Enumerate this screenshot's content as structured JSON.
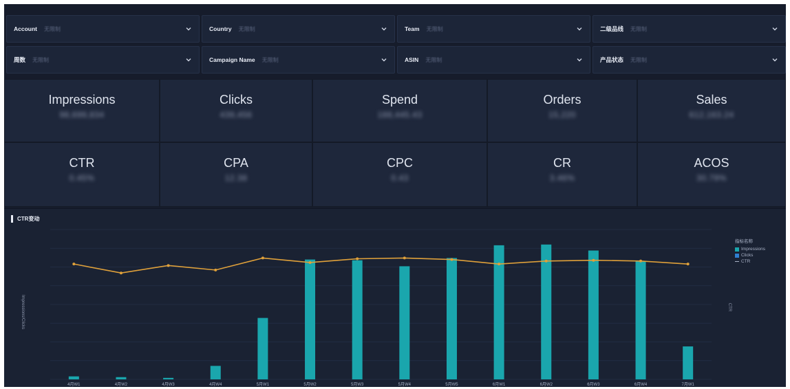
{
  "filters": [
    {
      "label": "Account",
      "value": "无限制"
    },
    {
      "label": "Country",
      "value": "无限制"
    },
    {
      "label": "Team",
      "value": "无限制"
    },
    {
      "label": "二级品线",
      "value": "无限制"
    },
    {
      "label": "周数",
      "value": "无限制"
    },
    {
      "label": "Campaign Name",
      "value": "无限制"
    },
    {
      "label": "ASIN",
      "value": "无限制"
    },
    {
      "label": "产品状态",
      "value": "无限制"
    }
  ],
  "kpis": [
    {
      "title": "Impressions",
      "value": "98,699,834"
    },
    {
      "title": "Clicks",
      "value": "439,456"
    },
    {
      "title": "Spend",
      "value": "188,445.43"
    },
    {
      "title": "Orders",
      "value": "15,220"
    },
    {
      "title": "Sales",
      "value": "612,163.24"
    },
    {
      "title": "CTR",
      "value": "0.45%"
    },
    {
      "title": "CPA",
      "value": "12.38"
    },
    {
      "title": "CPC",
      "value": "0.43"
    },
    {
      "title": "CR",
      "value": "3.46%"
    },
    {
      "title": "ACOS",
      "value": "30.79%"
    }
  ],
  "chart": {
    "title": "CTR变动",
    "left_axis_label": "Impressions/Clicks",
    "right_axis_label": "CTR",
    "legend_title": "指标名称",
    "legend_items": [
      "Impressions",
      "Clicks",
      "CTR"
    ],
    "colors": {
      "impressions": "#1aa6ad",
      "clicks": "#2f7fd1",
      "ctr": "#e0a13a"
    }
  },
  "chart_data": {
    "type": "bar",
    "categories": [
      "4月W1",
      "4月W2",
      "4月W3",
      "4月W4",
      "5月W1",
      "5月W2",
      "5月W3",
      "5月W4",
      "5月W5",
      "6月W1",
      "6月W2",
      "6月W3",
      "6月W4",
      "7月W1"
    ],
    "series": [
      {
        "name": "Impressions",
        "type": "bar",
        "axis": "left",
        "values": [
          2,
          1.5,
          1,
          9,
          41,
          80,
          79.5,
          75.5,
          81,
          89.5,
          90,
          86,
          79,
          22
        ]
      },
      {
        "name": "Clicks",
        "type": "bar",
        "axis": "left",
        "values": [
          0,
          0,
          0,
          0,
          0,
          0,
          0,
          0,
          0,
          0,
          0,
          0,
          0,
          0
        ]
      },
      {
        "name": "CTR",
        "type": "line",
        "axis": "right",
        "values": [
          77,
          71,
          76,
          73,
          81,
          78,
          80.5,
          81,
          80,
          77,
          79,
          79.5,
          79,
          77
        ]
      }
    ],
    "ylim": [
      0,
      100
    ],
    "grid": true,
    "legend": "right"
  }
}
